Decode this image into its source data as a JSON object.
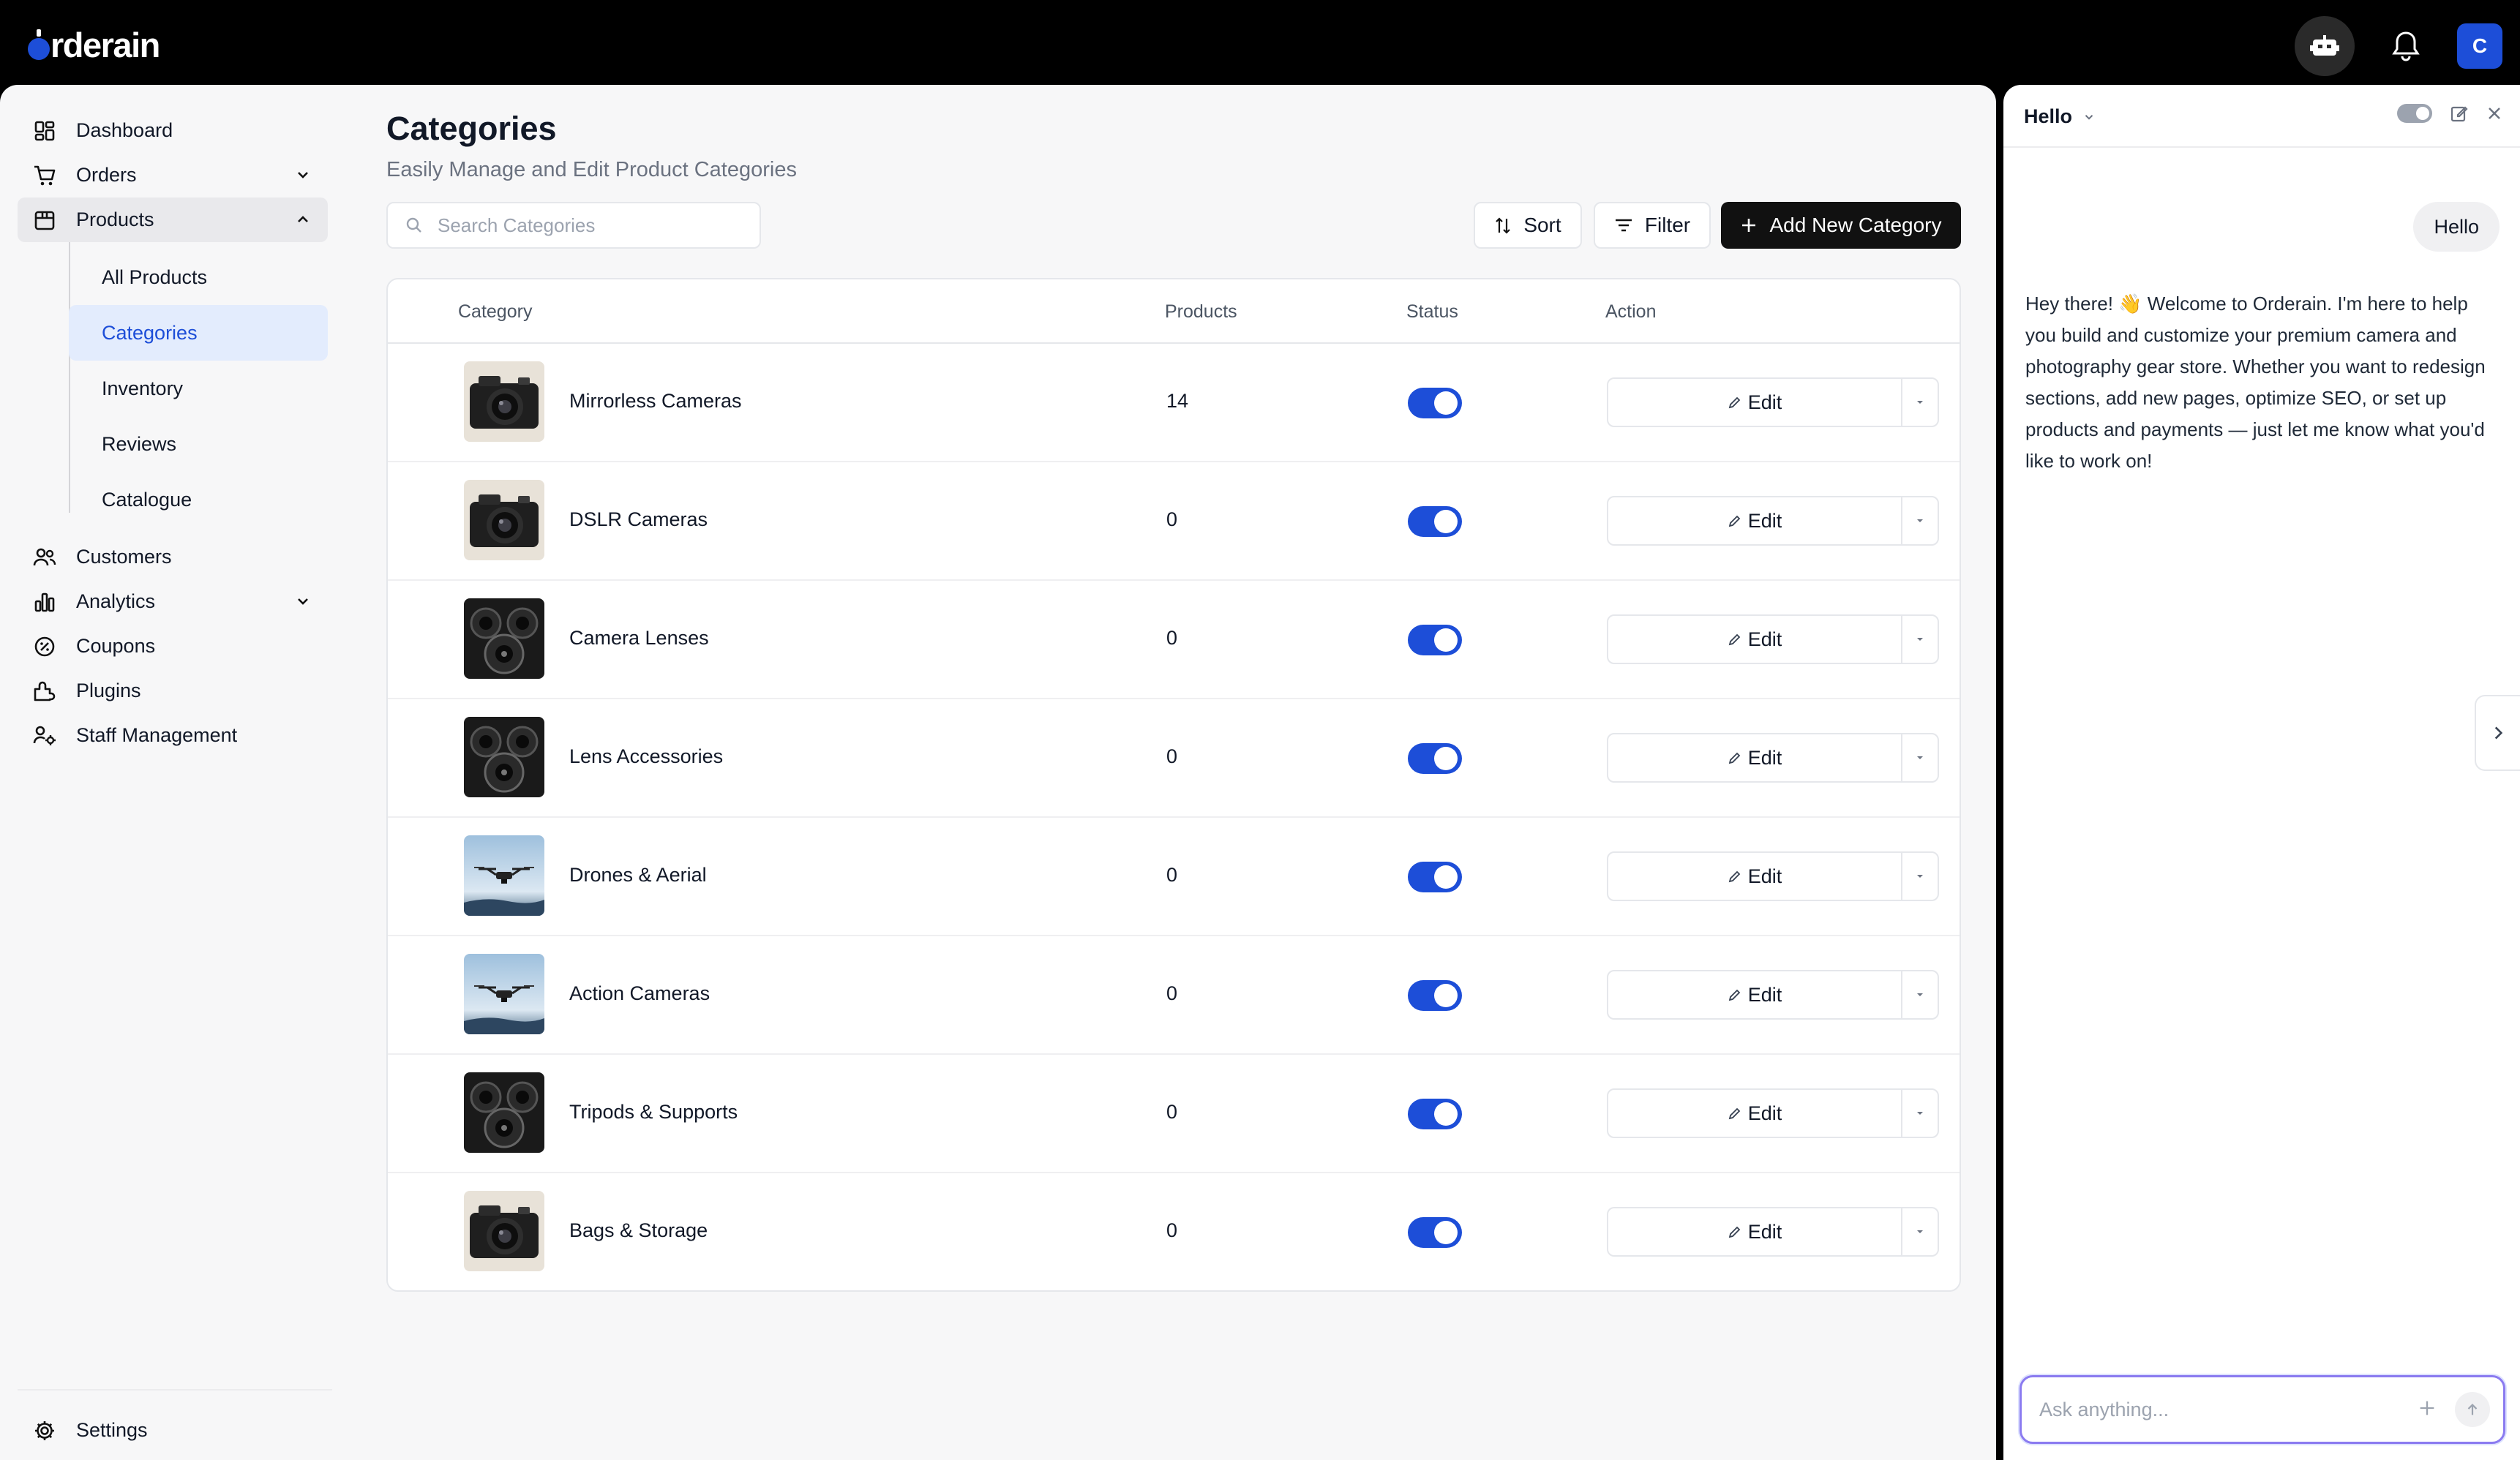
{
  "app": {
    "logo_text": "rderain"
  },
  "header": {
    "avatar_initial": "C"
  },
  "sidebar": {
    "items": [
      {
        "label": "Dashboard",
        "icon": "dashboard-icon"
      },
      {
        "label": "Orders",
        "icon": "cart-icon",
        "expandable": true
      },
      {
        "label": "Products",
        "icon": "box-icon",
        "expanded": true
      }
    ],
    "products_sub": [
      "All Products",
      "Categories",
      "Inventory",
      "Reviews",
      "Catalogue"
    ],
    "more_items": [
      {
        "label": "Customers",
        "icon": "users-icon"
      },
      {
        "label": "Analytics",
        "icon": "chart-icon",
        "expandable": true
      },
      {
        "label": "Coupons",
        "icon": "coupon-icon"
      },
      {
        "label": "Plugins",
        "icon": "plugin-icon"
      },
      {
        "label": "Staff Management",
        "icon": "staff-icon"
      }
    ],
    "settings_label": "Settings"
  },
  "page": {
    "title": "Categories",
    "subtitle": "Easily Manage and Edit Product Categories",
    "search_placeholder": "Search Categories",
    "sort_label": "Sort",
    "filter_label": "Filter",
    "add_label": "Add New Category"
  },
  "table": {
    "columns": [
      "Category",
      "Products",
      "Status",
      "Action"
    ],
    "edit_label": "Edit",
    "rows": [
      {
        "name": "Mirrorless Cameras",
        "products": "14",
        "status": true,
        "thumb": "camera"
      },
      {
        "name": "DSLR Cameras",
        "products": "0",
        "status": true,
        "thumb": "camera"
      },
      {
        "name": "Camera Lenses",
        "products": "0",
        "status": true,
        "thumb": "speakers"
      },
      {
        "name": "Lens Accessories",
        "products": "0",
        "status": true,
        "thumb": "speakers"
      },
      {
        "name": "Drones & Aerial",
        "products": "0",
        "status": true,
        "thumb": "drone"
      },
      {
        "name": "Action Cameras",
        "products": "0",
        "status": true,
        "thumb": "drone"
      },
      {
        "name": "Tripods & Supports",
        "products": "0",
        "status": true,
        "thumb": "speakers"
      },
      {
        "name": "Bags & Storage",
        "products": "0",
        "status": true,
        "thumb": "camera"
      }
    ]
  },
  "chat": {
    "title": "Hello",
    "user_message": "Hello",
    "bot_message": "Hey there! 👋 Welcome to Orderain. I'm here to help you build and customize your premium camera and photography gear store. Whether you want to redesign sections, add new pages, optimize SEO, or set up products and payments — just let me know what you'd like to work on!",
    "input_placeholder": "Ask anything..."
  },
  "colors": {
    "accent": "#1d4ed8",
    "active_bg": "#e3ecfd",
    "dark_button": "#111111"
  }
}
